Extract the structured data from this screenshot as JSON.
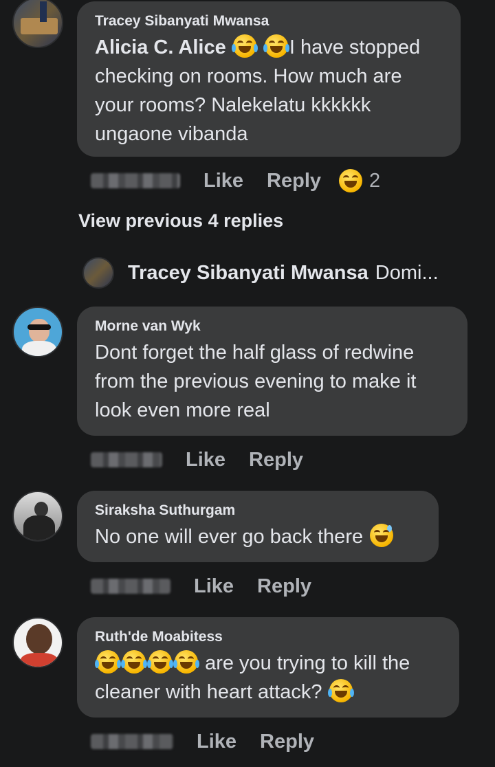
{
  "comments": [
    {
      "author": "Tracey Sibanyati Mwansa",
      "mention": "Alicia C. Alice",
      "text_line1_suffix": "I have stopped",
      "text_rest": "checking on rooms.  How much are your rooms? Nalekelatu kkkkkk ungaone vibanda",
      "like": "Like",
      "reply": "Reply",
      "reaction_count": "2"
    },
    {
      "author": "Morne van Wyk",
      "text": "Dont forget the half glass of redwine from the previous evening to make it look even more real",
      "like": "Like",
      "reply": "Reply"
    },
    {
      "author": "Siraksha Suthurgam",
      "text": "No one will ever go back there",
      "like": "Like",
      "reply": "Reply"
    },
    {
      "author": "Ruth'de Moabitess",
      "text_line1_suffix": "are you trying to kill the",
      "text_line2": "cleaner with heart attack?",
      "like": "Like",
      "reply": "Reply"
    }
  ],
  "view_previous": "View previous 4 replies",
  "reply_preview": {
    "author": "Tracey Sibanyati Mwansa",
    "snippet": "Domi..."
  },
  "icons": [
    "face-with-tears-of-joy-icon",
    "grinning-squinting-face-icon",
    "grinning-face-with-sweat-icon"
  ]
}
